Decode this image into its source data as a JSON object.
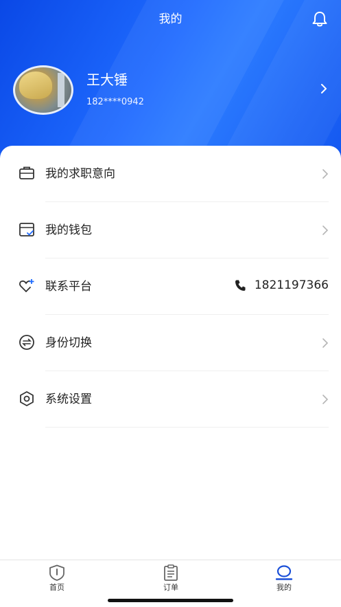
{
  "header": {
    "title": "我的",
    "bell_icon": "bell-icon"
  },
  "profile": {
    "name": "王大锤",
    "phone": "182****0942",
    "avatar_icon": "user-avatar",
    "chevron_icon": "chevron-right-icon"
  },
  "menu": {
    "items": [
      {
        "label": "我的求职意向",
        "icon": "briefcase-icon"
      },
      {
        "label": "我的钱包",
        "icon": "wallet-icon"
      },
      {
        "label": "联系平台",
        "icon": "heart-plus-icon",
        "value": "1821197366",
        "value_icon": "phone-icon"
      },
      {
        "label": "身份切换",
        "icon": "switch-icon"
      },
      {
        "label": "系统设置",
        "icon": "settings-hexagon-icon"
      }
    ]
  },
  "tabbar": {
    "items": [
      {
        "label": "首页",
        "icon": "home-shield-icon",
        "active": false
      },
      {
        "label": "订单",
        "icon": "clipboard-icon",
        "active": false
      },
      {
        "label": "我的",
        "icon": "profile-icon",
        "active": true
      }
    ]
  },
  "colors": {
    "brand": "#1f6bff",
    "active_tab": "#1a4fd8"
  }
}
